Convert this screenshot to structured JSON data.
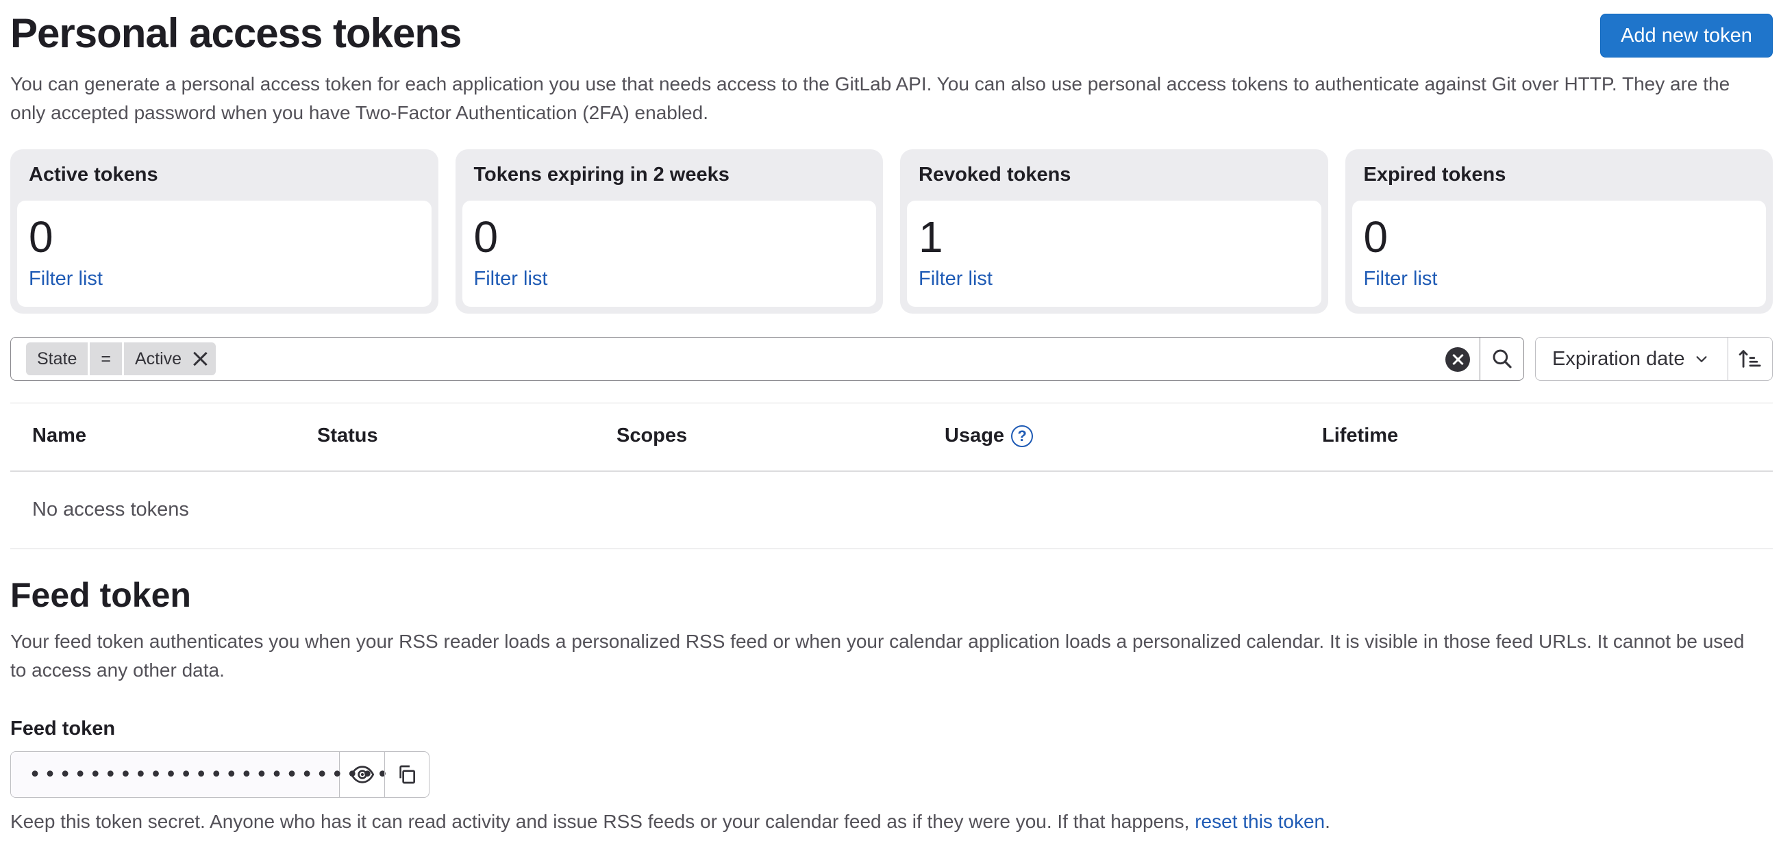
{
  "header": {
    "title": "Personal access tokens",
    "add_button_label": "Add new token",
    "description": "You can generate a personal access token for each application you use that needs access to the GitLab API. You can also use personal access tokens to authenticate against Git over HTTP. They are the only accepted password when you have Two-Factor Authentication (2FA) enabled."
  },
  "stats": [
    {
      "title": "Active tokens",
      "value": "0",
      "link": "Filter list"
    },
    {
      "title": "Tokens expiring in 2 weeks",
      "value": "0",
      "link": "Filter list"
    },
    {
      "title": "Revoked tokens",
      "value": "1",
      "link": "Filter list"
    },
    {
      "title": "Expired tokens",
      "value": "0",
      "link": "Filter list"
    }
  ],
  "filter": {
    "token_key": "State",
    "token_operator": "=",
    "token_value": "Active",
    "sort_label": "Expiration date"
  },
  "table": {
    "columns": [
      "Name",
      "Status",
      "Scopes",
      "Usage",
      "Lifetime"
    ],
    "usage_help_glyph": "?",
    "empty_text": "No access tokens"
  },
  "feed": {
    "title": "Feed token",
    "description": "Your feed token authenticates you when your RSS reader loads a personalized RSS feed or when your calendar application loads a personalized calendar. It is visible in those feed URLs. It cannot be used to access any other data.",
    "field_label": "Feed token",
    "masked_value": "••••••••••••••••••••••••",
    "help_text": "Keep this token secret. Anyone who has it can read activity and issue RSS feeds or your calendar feed as if they were you. If that happens,",
    "reset_link": "reset this token",
    "help_suffix": "."
  },
  "colors": {
    "primary": "#1f75cb",
    "link": "#1f5bb5",
    "card_bg": "#ececef"
  }
}
